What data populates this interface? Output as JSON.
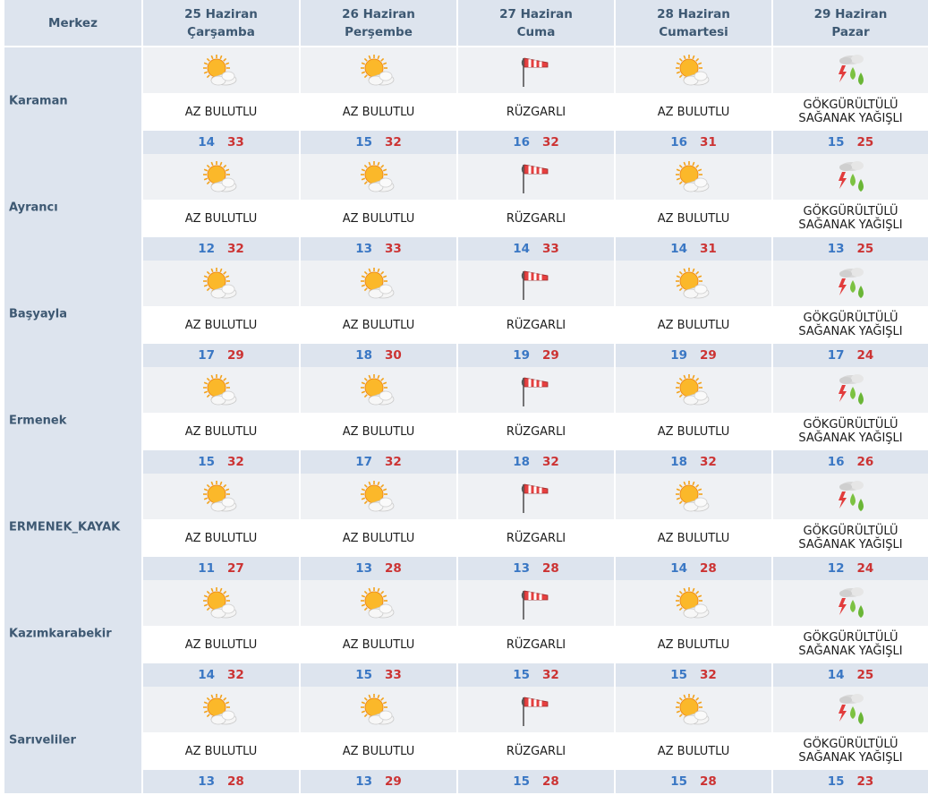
{
  "header": {
    "center_label": "Merkez",
    "days": [
      {
        "date": "25 Haziran",
        "weekday": "Çarşamba"
      },
      {
        "date": "26 Haziran",
        "weekday": "Perşembe"
      },
      {
        "date": "27 Haziran",
        "weekday": "Cuma"
      },
      {
        "date": "28 Haziran",
        "weekday": "Cumartesi"
      },
      {
        "date": "29 Haziran",
        "weekday": "Pazar"
      }
    ]
  },
  "colors": {
    "min_temp": "#3a77c4",
    "max_temp": "#cc3333",
    "header_bg": "#dde4ee",
    "header_text": "#3d5872"
  },
  "rows": [
    {
      "city": "Karaman",
      "forecasts": [
        {
          "icon": "partly-cloudy-sun-icon",
          "line1": "AZ BULUTLU",
          "line2": "",
          "min": "14",
          "max": "33"
        },
        {
          "icon": "partly-cloudy-sun-icon",
          "line1": "AZ BULUTLU",
          "line2": "",
          "min": "15",
          "max": "32"
        },
        {
          "icon": "windsock-icon",
          "line1": "RÜZGARLI",
          "line2": "",
          "min": "16",
          "max": "32"
        },
        {
          "icon": "partly-cloudy-sun-icon",
          "line1": "AZ BULUTLU",
          "line2": "",
          "min": "16",
          "max": "31"
        },
        {
          "icon": "thunderstorm-rain-icon",
          "line1": "GÖKGÜRÜLTÜLÜ",
          "line2": "SAĞANAK YAĞIŞLI",
          "min": "15",
          "max": "25"
        }
      ]
    },
    {
      "city": "Ayrancı",
      "forecasts": [
        {
          "icon": "partly-cloudy-sun-icon",
          "line1": "AZ BULUTLU",
          "line2": "",
          "min": "12",
          "max": "32"
        },
        {
          "icon": "partly-cloudy-sun-icon",
          "line1": "AZ BULUTLU",
          "line2": "",
          "min": "13",
          "max": "33"
        },
        {
          "icon": "windsock-icon",
          "line1": "RÜZGARLI",
          "line2": "",
          "min": "14",
          "max": "33"
        },
        {
          "icon": "partly-cloudy-sun-icon",
          "line1": "AZ BULUTLU",
          "line2": "",
          "min": "14",
          "max": "31"
        },
        {
          "icon": "thunderstorm-rain-icon",
          "line1": "GÖKGÜRÜLTÜLÜ",
          "line2": "SAĞANAK YAĞIŞLI",
          "min": "13",
          "max": "25"
        }
      ]
    },
    {
      "city": "Başyayla",
      "forecasts": [
        {
          "icon": "partly-cloudy-sun-icon",
          "line1": "AZ BULUTLU",
          "line2": "",
          "min": "17",
          "max": "29"
        },
        {
          "icon": "partly-cloudy-sun-icon",
          "line1": "AZ BULUTLU",
          "line2": "",
          "min": "18",
          "max": "30"
        },
        {
          "icon": "windsock-icon",
          "line1": "RÜZGARLI",
          "line2": "",
          "min": "19",
          "max": "29"
        },
        {
          "icon": "partly-cloudy-sun-icon",
          "line1": "AZ BULUTLU",
          "line2": "",
          "min": "19",
          "max": "29"
        },
        {
          "icon": "thunderstorm-rain-icon",
          "line1": "GÖKGÜRÜLTÜLÜ",
          "line2": "SAĞANAK YAĞIŞLI",
          "min": "17",
          "max": "24"
        }
      ]
    },
    {
      "city": "Ermenek",
      "forecasts": [
        {
          "icon": "partly-cloudy-sun-icon",
          "line1": "AZ BULUTLU",
          "line2": "",
          "min": "15",
          "max": "32"
        },
        {
          "icon": "partly-cloudy-sun-icon",
          "line1": "AZ BULUTLU",
          "line2": "",
          "min": "17",
          "max": "32"
        },
        {
          "icon": "windsock-icon",
          "line1": "RÜZGARLI",
          "line2": "",
          "min": "18",
          "max": "32"
        },
        {
          "icon": "partly-cloudy-sun-icon",
          "line1": "AZ BULUTLU",
          "line2": "",
          "min": "18",
          "max": "32"
        },
        {
          "icon": "thunderstorm-rain-icon",
          "line1": "GÖKGÜRÜLTÜLÜ",
          "line2": "SAĞANAK YAĞIŞLI",
          "min": "16",
          "max": "26"
        }
      ]
    },
    {
      "city": "ERMENEK_KAYAK",
      "forecasts": [
        {
          "icon": "partly-cloudy-sun-icon",
          "line1": "AZ BULUTLU",
          "line2": "",
          "min": "11",
          "max": "27"
        },
        {
          "icon": "partly-cloudy-sun-icon",
          "line1": "AZ BULUTLU",
          "line2": "",
          "min": "13",
          "max": "28"
        },
        {
          "icon": "windsock-icon",
          "line1": "RÜZGARLI",
          "line2": "",
          "min": "13",
          "max": "28"
        },
        {
          "icon": "partly-cloudy-sun-icon",
          "line1": "AZ BULUTLU",
          "line2": "",
          "min": "14",
          "max": "28"
        },
        {
          "icon": "thunderstorm-rain-icon",
          "line1": "GÖKGÜRÜLTÜLÜ",
          "line2": "SAĞANAK YAĞIŞLI",
          "min": "12",
          "max": "24"
        }
      ]
    },
    {
      "city": "Kazımkarabekir",
      "forecasts": [
        {
          "icon": "partly-cloudy-sun-icon",
          "line1": "AZ BULUTLU",
          "line2": "",
          "min": "14",
          "max": "32"
        },
        {
          "icon": "partly-cloudy-sun-icon",
          "line1": "AZ BULUTLU",
          "line2": "",
          "min": "15",
          "max": "33"
        },
        {
          "icon": "windsock-icon",
          "line1": "RÜZGARLI",
          "line2": "",
          "min": "15",
          "max": "32"
        },
        {
          "icon": "partly-cloudy-sun-icon",
          "line1": "AZ BULUTLU",
          "line2": "",
          "min": "15",
          "max": "32"
        },
        {
          "icon": "thunderstorm-rain-icon",
          "line1": "GÖKGÜRÜLTÜLÜ",
          "line2": "SAĞANAK YAĞIŞLI",
          "min": "14",
          "max": "25"
        }
      ]
    },
    {
      "city": "Sarıveliler",
      "forecasts": [
        {
          "icon": "partly-cloudy-sun-icon",
          "line1": "AZ BULUTLU",
          "line2": "",
          "min": "13",
          "max": "28"
        },
        {
          "icon": "partly-cloudy-sun-icon",
          "line1": "AZ BULUTLU",
          "line2": "",
          "min": "13",
          "max": "29"
        },
        {
          "icon": "windsock-icon",
          "line1": "RÜZGARLI",
          "line2": "",
          "min": "15",
          "max": "28"
        },
        {
          "icon": "partly-cloudy-sun-icon",
          "line1": "AZ BULUTLU",
          "line2": "",
          "min": "15",
          "max": "28"
        },
        {
          "icon": "thunderstorm-rain-icon",
          "line1": "GÖKGÜRÜLTÜLÜ",
          "line2": "SAĞANAK YAĞIŞLI",
          "min": "15",
          "max": "23"
        }
      ]
    }
  ]
}
